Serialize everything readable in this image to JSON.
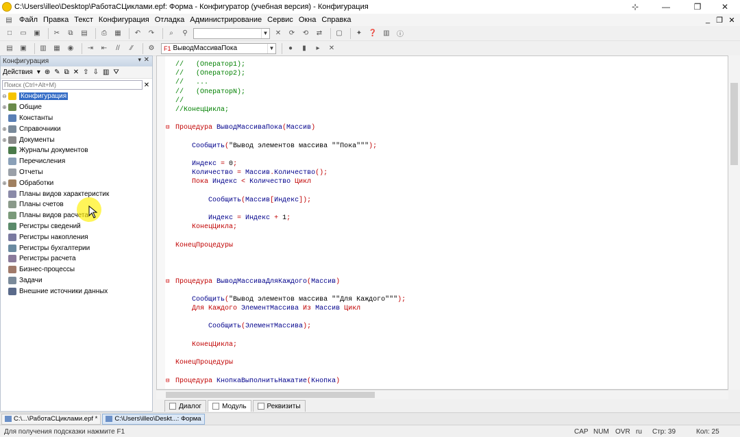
{
  "window": {
    "title": "C:\\Users\\illeo\\Desktop\\РаботаСЦиклами.epf: Форма - Конфигуратор (учебная версия) - Конфигурация"
  },
  "menu": [
    "Файл",
    "Правка",
    "Текст",
    "Конфигурация",
    "Отладка",
    "Администрирование",
    "Сервис",
    "Окна",
    "Справка"
  ],
  "toolbar2": {
    "procedure_combo": "ВыводМассиваПока"
  },
  "left_panel": {
    "title": "Конфигурация",
    "actions_label": "Действия",
    "search_placeholder": "Поиск (Ctrl+Alt+M)",
    "tree": [
      {
        "label": "Конфигурация",
        "color": "#f5c400",
        "expand": "⊖"
      },
      {
        "label": "Общие",
        "color": "#6a8a4a",
        "expand": "⊕"
      },
      {
        "label": "Константы",
        "color": "#5a7fb5",
        "expand": ""
      },
      {
        "label": "Справочники",
        "color": "#7a8a9a",
        "expand": "⊕"
      },
      {
        "label": "Документы",
        "color": "#8a8a8a",
        "expand": "⊕"
      },
      {
        "label": "Журналы документов",
        "color": "#4a7a4a",
        "expand": ""
      },
      {
        "label": "Перечисления",
        "color": "#8aa0b8",
        "expand": ""
      },
      {
        "label": "Отчеты",
        "color": "#9aa0a8",
        "expand": ""
      },
      {
        "label": "Обработки",
        "color": "#a08060",
        "expand": "⊕"
      },
      {
        "label": "Планы видов характеристик",
        "color": "#8a8aa8",
        "expand": ""
      },
      {
        "label": "Планы счетов",
        "color": "#8a9a8a",
        "expand": ""
      },
      {
        "label": "Планы видов расчета",
        "color": "#7a9a7a",
        "expand": ""
      },
      {
        "label": "Регистры сведений",
        "color": "#5a8a6a",
        "expand": ""
      },
      {
        "label": "Регистры накопления",
        "color": "#7a7aa0",
        "expand": ""
      },
      {
        "label": "Регистры бухгалтерии",
        "color": "#6a8aa0",
        "expand": ""
      },
      {
        "label": "Регистры расчета",
        "color": "#8a7a9a",
        "expand": ""
      },
      {
        "label": "Бизнес-процессы",
        "color": "#a07a6a",
        "expand": ""
      },
      {
        "label": "Задачи",
        "color": "#7a8a9a",
        "expand": ""
      },
      {
        "label": "Внешние источники данных",
        "color": "#5a6a8a",
        "expand": ""
      }
    ]
  },
  "code": [
    [
      [
        "cm",
        "//   (Оператор1);"
      ]
    ],
    [
      [
        "cm",
        "//   (Оператор2);"
      ]
    ],
    [
      [
        "cm",
        "//   ..."
      ]
    ],
    [
      [
        "cm",
        "//   (ОператорN);"
      ]
    ],
    [
      [
        "cm",
        "//"
      ]
    ],
    [
      [
        "cm",
        "//КонецЦикла;"
      ]
    ],
    [],
    [
      [
        "kw",
        "Процедура "
      ],
      [
        "id",
        "ВыводМассиваПока"
      ],
      [
        "op",
        "("
      ],
      [
        "id",
        "Массив"
      ],
      [
        "op",
        ")"
      ]
    ],
    [],
    [
      [
        "pl",
        "    "
      ],
      [
        "id",
        "Сообщить"
      ],
      [
        "op",
        "("
      ],
      [
        "st",
        "\"Вывод элементов массива \"\"Пока\"\"\""
      ],
      [
        "op",
        ");"
      ]
    ],
    [],
    [
      [
        "pl",
        "    "
      ],
      [
        "id",
        "Индекс"
      ],
      [
        "op",
        " = "
      ],
      [
        "st",
        "0"
      ],
      [
        "op",
        ";"
      ]
    ],
    [
      [
        "pl",
        "    "
      ],
      [
        "id",
        "Количество"
      ],
      [
        "op",
        " = "
      ],
      [
        "id",
        "Массив"
      ],
      [
        "op",
        "."
      ],
      [
        "id",
        "Количество"
      ],
      [
        "op",
        "();"
      ]
    ],
    [
      [
        "pl",
        "    "
      ],
      [
        "kw",
        "Пока "
      ],
      [
        "id",
        "Индекс"
      ],
      [
        "op",
        " < "
      ],
      [
        "id",
        "Количество"
      ],
      [
        "kw",
        " Цикл"
      ]
    ],
    [],
    [
      [
        "pl",
        "        "
      ],
      [
        "id",
        "Сообщить"
      ],
      [
        "op",
        "("
      ],
      [
        "id",
        "Массив"
      ],
      [
        "op",
        "["
      ],
      [
        "id",
        "Индекс"
      ],
      [
        "op",
        "]);"
      ]
    ],
    [],
    [
      [
        "pl",
        "        "
      ],
      [
        "id",
        "Индекс"
      ],
      [
        "op",
        " = "
      ],
      [
        "id",
        "Индекс"
      ],
      [
        "op",
        " + "
      ],
      [
        "st",
        "1"
      ],
      [
        "op",
        ";"
      ]
    ],
    [
      [
        "pl",
        "    "
      ],
      [
        "kw",
        "КонецЦикла"
      ],
      [
        "op",
        ";"
      ]
    ],
    [],
    [
      [
        "kw",
        "КонецПроцедуры"
      ]
    ],
    [],
    [],
    [],
    [
      [
        "kw",
        "Процедура "
      ],
      [
        "id",
        "ВыводМассиваДляКаждого"
      ],
      [
        "op",
        "("
      ],
      [
        "id",
        "Массив"
      ],
      [
        "op",
        ")"
      ]
    ],
    [],
    [
      [
        "pl",
        "    "
      ],
      [
        "id",
        "Сообщить"
      ],
      [
        "op",
        "("
      ],
      [
        "st",
        "\"Вывод элементов массива \"\"Для Каждого\"\"\""
      ],
      [
        "op",
        ");"
      ]
    ],
    [
      [
        "pl",
        "    "
      ],
      [
        "kw",
        "Для Каждого "
      ],
      [
        "id",
        "ЭлементМассива"
      ],
      [
        "kw",
        " Из "
      ],
      [
        "id",
        "Массив"
      ],
      [
        "kw",
        " Цикл"
      ]
    ],
    [],
    [
      [
        "pl",
        "        "
      ],
      [
        "id",
        "Сообщить"
      ],
      [
        "op",
        "("
      ],
      [
        "id",
        "ЭлементМассива"
      ],
      [
        "op",
        ");"
      ]
    ],
    [],
    [
      [
        "pl",
        "    "
      ],
      [
        "kw",
        "КонецЦикла"
      ],
      [
        "op",
        ";"
      ]
    ],
    [],
    [
      [
        "kw",
        "КонецПроцедуры"
      ]
    ],
    [],
    [
      [
        "kw",
        "Процедура "
      ],
      [
        "id",
        "КнопкаВыполнитьНажатие"
      ],
      [
        "op",
        "("
      ],
      [
        "id",
        "Кнопка"
      ],
      [
        "op",
        ")"
      ]
    ]
  ],
  "tabs": [
    "Диалог",
    "Модуль",
    "Реквизиты"
  ],
  "taskbar": [
    "C:\\...\\РаботаСЦиклами.epf *",
    "C:\\Users\\illeo\\Deskt...: Форма"
  ],
  "status": {
    "hint": "Для получения подсказки нажмите F1",
    "cap": "CAP",
    "num": "NUM",
    "ovr": "OVR",
    "lang": "ru",
    "line": "Стр: 39",
    "col": "Кол: 25"
  }
}
